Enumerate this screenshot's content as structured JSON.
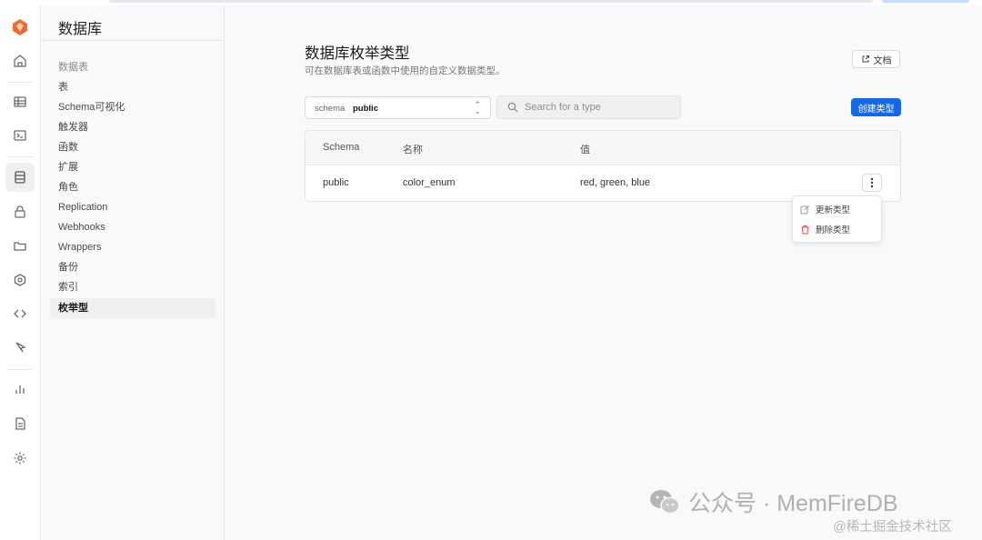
{
  "sidebar": {
    "title": "数据库",
    "group_label": "数据表",
    "items": [
      {
        "label": "表"
      },
      {
        "label": "Schema可视化"
      },
      {
        "label": "触发器"
      },
      {
        "label": "函数"
      },
      {
        "label": "扩展"
      },
      {
        "label": "角色"
      },
      {
        "label": "Replication"
      },
      {
        "label": "Webhooks"
      },
      {
        "label": "Wrappers"
      },
      {
        "label": "备份"
      },
      {
        "label": "索引"
      },
      {
        "label": "枚举型"
      }
    ],
    "active_item": "枚举型"
  },
  "rail": {
    "icons": [
      "logo-icon",
      "home-icon",
      "table-editor-icon",
      "sql-editor-icon",
      "database-icon",
      "auth-icon",
      "storage-icon",
      "edge-functions-icon",
      "api-icon",
      "realtime-icon",
      "reports-icon",
      "logs-icon",
      "settings-icon"
    ],
    "active": "database-icon"
  },
  "main": {
    "title": "数据库枚举类型",
    "subtitle": "可在数据库表或函数中使用的自定义数据类型。",
    "docs_label": "文档",
    "schema_label": "schema",
    "schema_value": "public",
    "search_placeholder": "Search for a type",
    "create_label": "创建类型"
  },
  "table": {
    "columns": [
      "Schema",
      "名称",
      "值"
    ],
    "rows": [
      {
        "schema": "public",
        "name": "color_enum",
        "values": "red, green, blue"
      }
    ]
  },
  "row_menu": {
    "items": [
      {
        "label": "更新类型"
      },
      {
        "label": "删除类型"
      }
    ]
  },
  "colors": {
    "primary": "#1667e3",
    "brand": "#f06a2b",
    "danger": "#e5484d"
  },
  "watermark": {
    "main": "公众号 · MemFireDB",
    "sub": "@稀土掘金技术社区"
  }
}
